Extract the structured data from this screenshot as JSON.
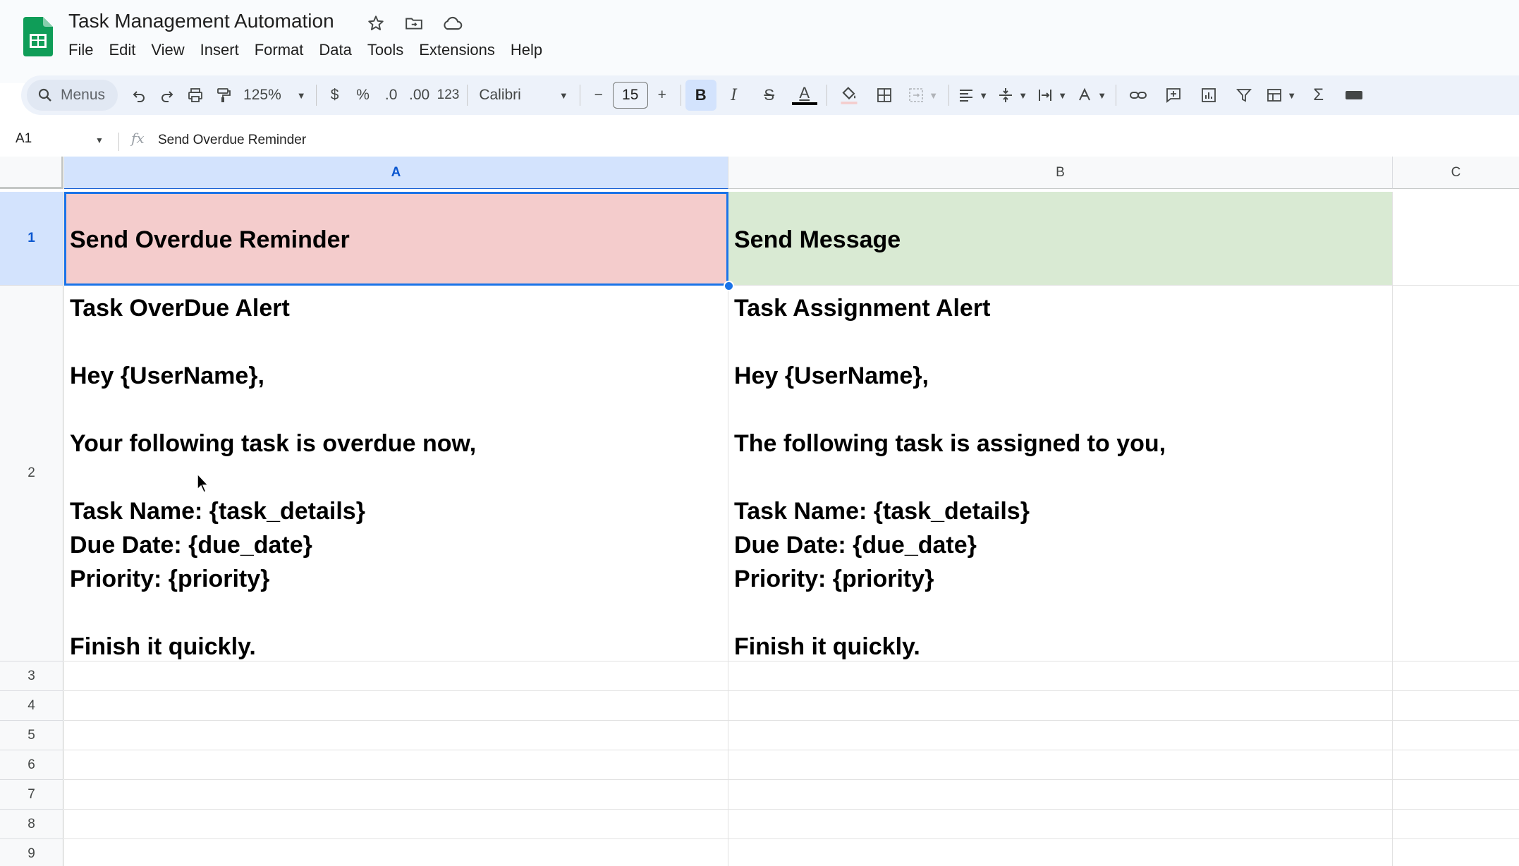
{
  "app": {
    "title": "Task Management Automation",
    "menus": [
      "File",
      "Edit",
      "View",
      "Insert",
      "Format",
      "Data",
      "Tools",
      "Extensions",
      "Help"
    ],
    "title_icons": [
      "star-icon",
      "move-folder-icon",
      "cloud-status-icon"
    ]
  },
  "toolbar": {
    "search_label": "Menus",
    "zoom": "125%",
    "currency": "$",
    "percent": "%",
    "decrease_decimal": ".0",
    "increase_decimal": ".00",
    "number_format": "123",
    "font": "Calibri",
    "font_size": "15",
    "minus": "−",
    "plus": "+",
    "bold": "B",
    "italic": "I",
    "strike": "S",
    "text_color": "A",
    "sigma": "Σ"
  },
  "formula_bar": {
    "cell_ref": "A1",
    "fx": "fx",
    "content": "Send Overdue Reminder"
  },
  "grid": {
    "columns": [
      "A",
      "B",
      "C"
    ],
    "selected_column": "A",
    "rows": [
      "1",
      "2",
      "3",
      "4",
      "5",
      "6",
      "7",
      "8",
      "9"
    ],
    "selected_row": "1",
    "cells": {
      "A1": "Send Overdue Reminder",
      "B1": "Send Message",
      "A2": "Task OverDue Alert\n\nHey {UserName},\n\nYour following task is overdue now,\n\nTask Name: {task_details}\nDue Date: {due_date}\nPriority: {priority}\n\nFinish it quickly.",
      "B2": "Task Assignment Alert\n\nHey {UserName},\n\nThe following task is assigned to you,\n\nTask Name: {task_details}\nDue Date: {due_date}\nPriority: {priority}\n\nFinish it quickly."
    },
    "fill_colors": {
      "A1": "#f4cccc",
      "B1": "#d9ead3"
    }
  },
  "colors": {
    "selection": "#1a73e8",
    "header_bg": "#f8f9fa",
    "toolbar_bg": "#edf2fa",
    "sheets_green": "#0f9d58"
  }
}
